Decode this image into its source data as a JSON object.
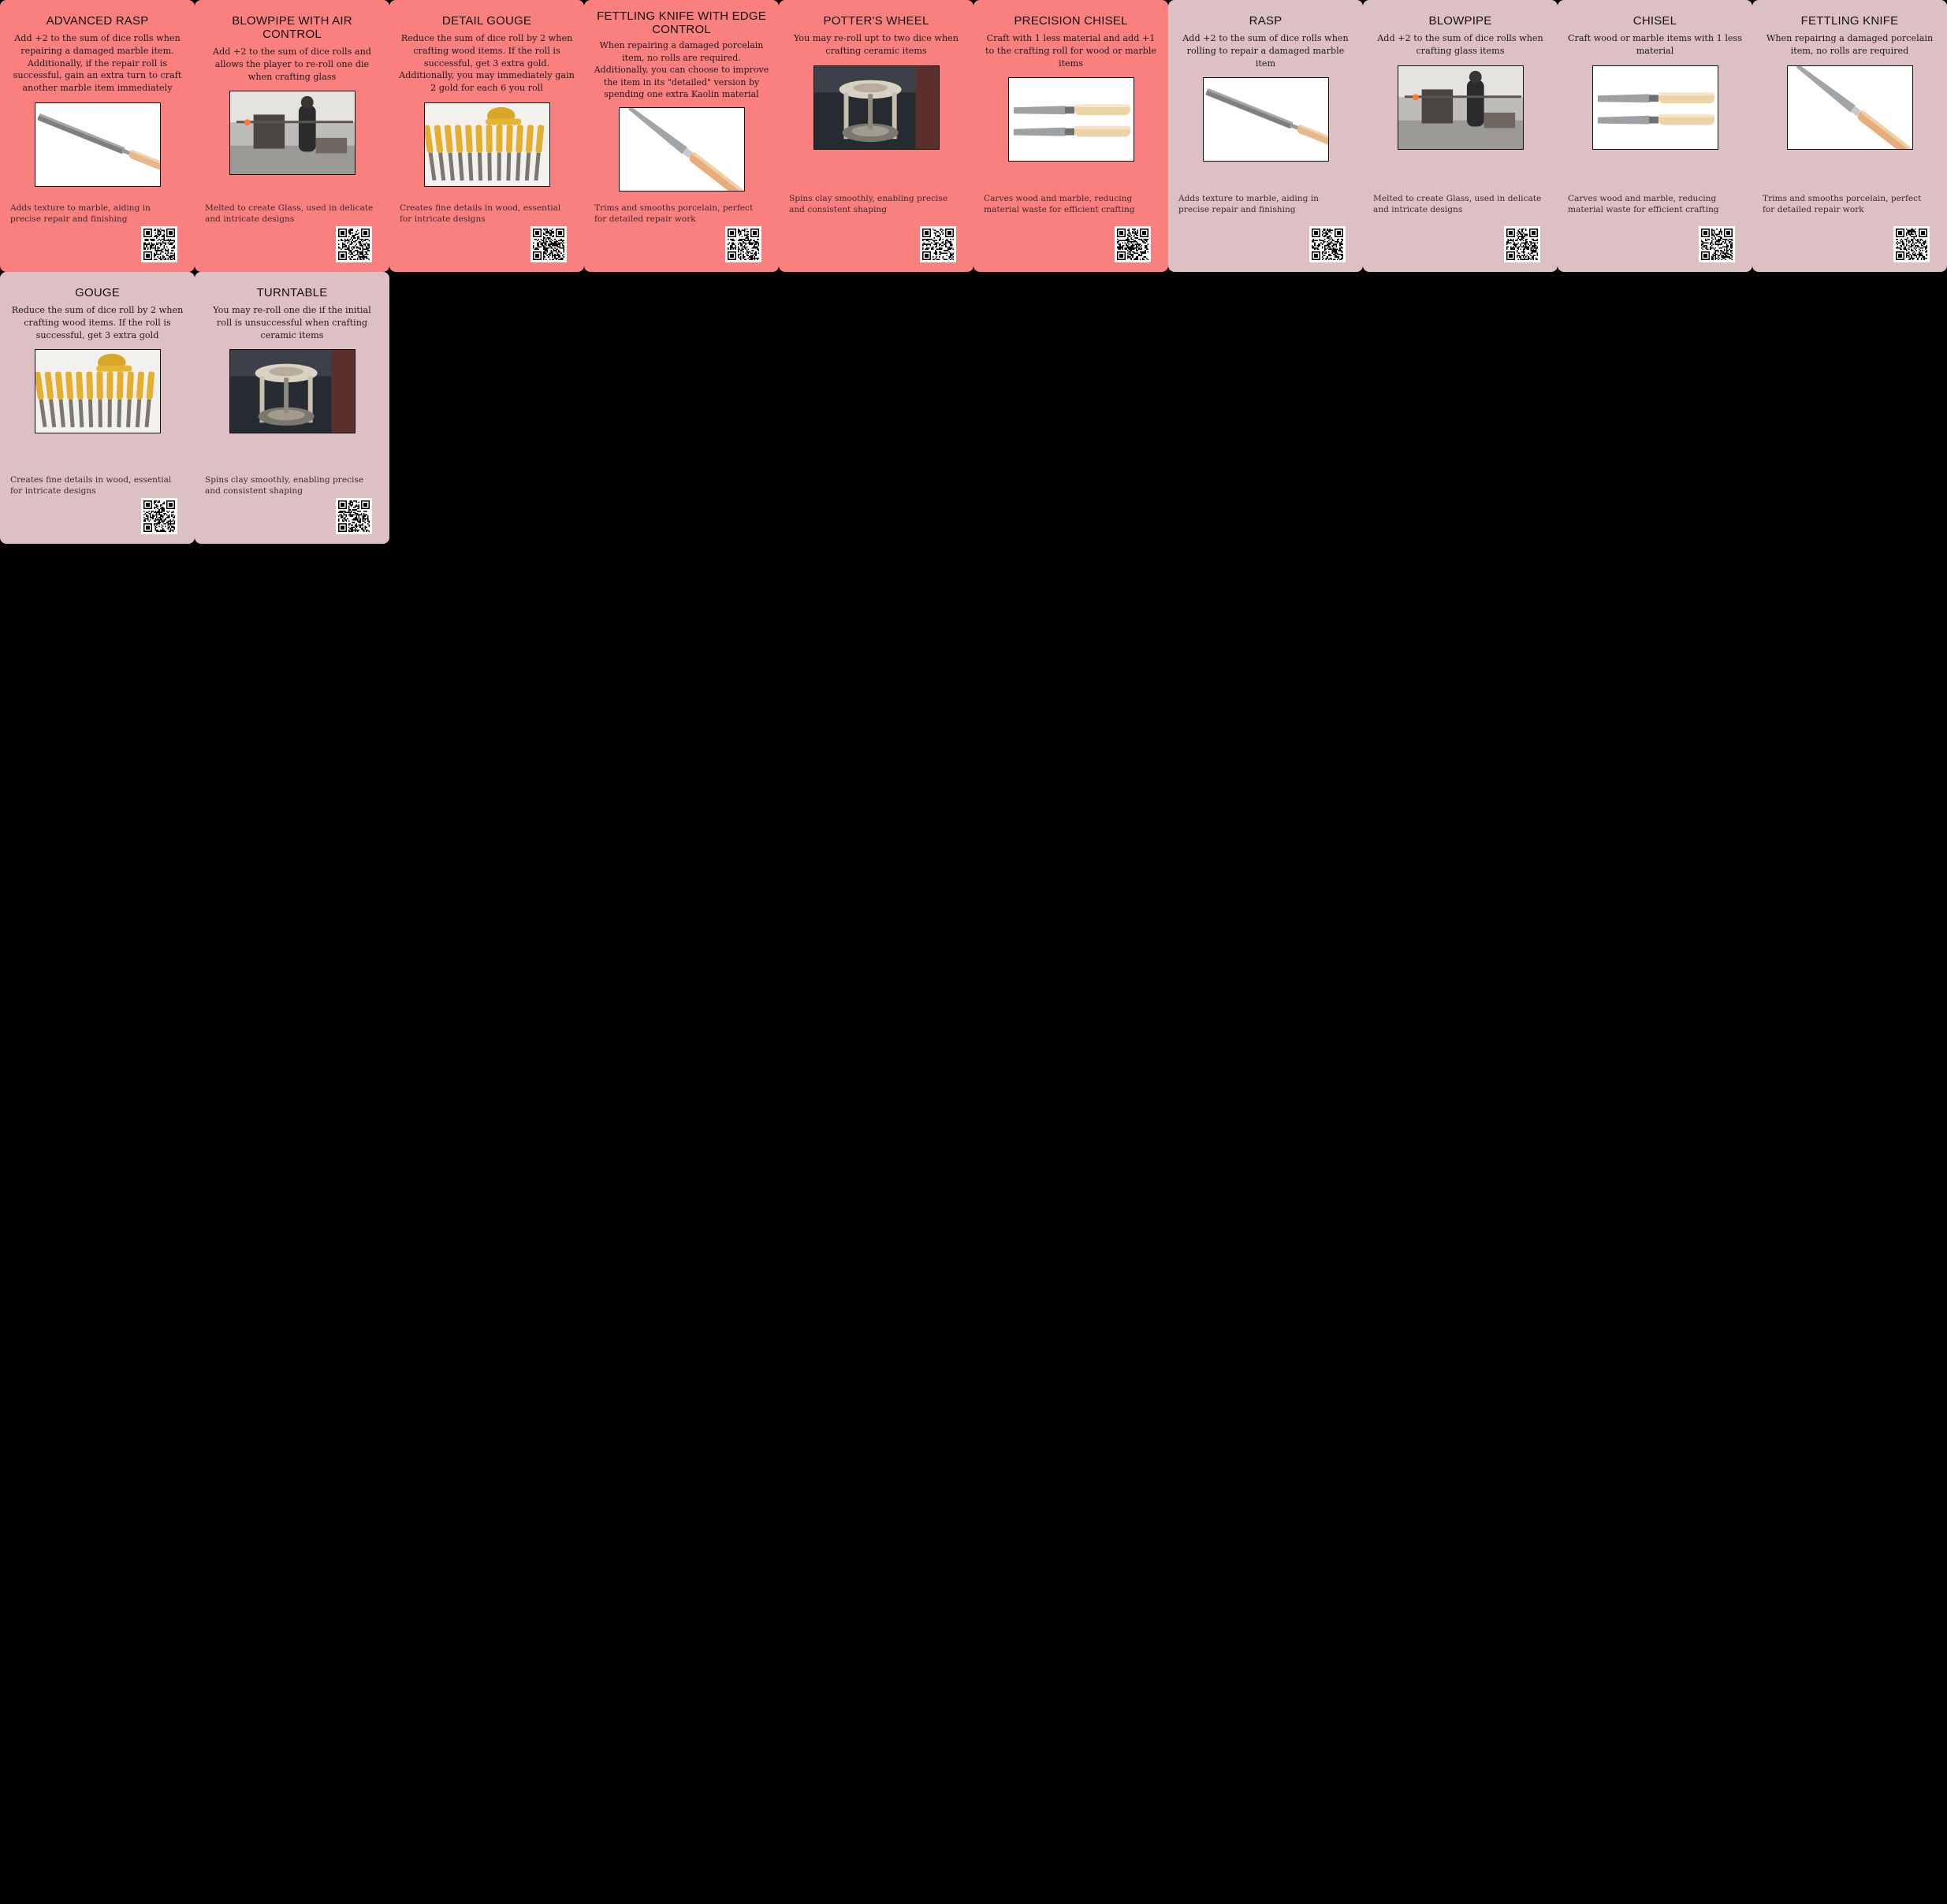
{
  "cards": [
    {
      "tier": "upgraded",
      "layout": "tall",
      "title": "ADVANCED RASP",
      "rule": "Add +2 to the sum of dice rolls when repairing a damaged marble item. Additionally, if the repair roll is successful, gain an extra turn to craft another marble item immediately",
      "image": "rasp-image",
      "flavor": "Adds texture to marble, aiding in precise repair and finishing",
      "qr": "qr-code-icon"
    },
    {
      "tier": "upgraded",
      "layout": "tall",
      "title": "BLOWPIPE WITH AIR CONTROL",
      "rule": "Add +2 to the sum of dice rolls and allows the player to re-roll one die when crafting glass",
      "image": "blowpipe-image",
      "flavor": "Melted to create Glass, used in delicate and intricate designs",
      "qr": "qr-code-icon"
    },
    {
      "tier": "upgraded",
      "layout": "tall",
      "title": "DETAIL GOUGE",
      "rule": "Reduce the sum of dice roll by 2 when crafting wood items. If the roll is successful, get 3 extra gold. Additionally, you may immediately gain 2 gold for each 6 you roll",
      "image": "gouge-image",
      "flavor": "Creates fine details in wood, essential for intricate designs",
      "qr": "qr-code-icon"
    },
    {
      "tier": "upgraded",
      "layout": "long",
      "title": "FETTLING KNIFE WITH EDGE CONTROL",
      "rule": "When repairing a damaged porcelain item, no rolls are required. Additionally, you can choose to improve the item in its \"detailed\" version by spending one extra Kaolin material",
      "image": "knife-image",
      "flavor": "Trims and smooths porcelain, perfect for detailed repair work",
      "qr": "qr-code-icon"
    },
    {
      "tier": "upgraded",
      "layout": "short",
      "title": "POTTER'S WHEEL",
      "rule": "You may re-roll upt to two dice when crafting ceramic items",
      "image": "wheel-image",
      "flavor": "Spins clay smoothly, enabling precise and consistent shaping",
      "qr": "qr-code-icon"
    },
    {
      "tier": "upgraded",
      "layout": "short",
      "title": "PRECISION CHISEL",
      "rule": "Craft with 1 less material and add +1 to the crafting roll for wood or marble items",
      "image": "chisel-image",
      "flavor": "Carves wood and marble, reducing material waste for efficient crafting",
      "qr": "qr-code-icon"
    },
    {
      "tier": "basic",
      "layout": "short",
      "title": "RASP",
      "rule": "Add +2 to the sum of dice rolls when rolling to repair a damaged marble item",
      "image": "rasp-image",
      "flavor": "Adds texture to marble, aiding in precise repair and finishing",
      "qr": "qr-code-icon"
    },
    {
      "tier": "basic",
      "layout": "short",
      "title": "BLOWPIPE",
      "rule": "Add +2 to the sum of dice rolls when crafting glass items",
      "image": "blowpipe-image",
      "flavor": "Melted to create Glass, used in delicate and intricate designs",
      "qr": "qr-code-icon"
    },
    {
      "tier": "basic",
      "layout": "short",
      "title": "CHISEL",
      "rule": "Craft wood or marble items with 1 less material",
      "image": "chisel-image",
      "flavor": "Carves wood and marble, reducing material waste for efficient crafting",
      "qr": "qr-code-icon"
    },
    {
      "tier": "basic",
      "layout": "short",
      "title": "FETTLING KNIFE",
      "rule": "When repairing a damaged porcelain item, no rolls are required",
      "image": "knife-image",
      "flavor": "Trims and smooths porcelain, perfect for detailed repair work",
      "qr": "qr-code-icon"
    },
    {
      "tier": "basic",
      "layout": "tall",
      "title": "GOUGE",
      "rule": "Reduce the sum of dice roll by 2 when crafting wood items. If the roll is successful, get 3 extra gold",
      "image": "gouge-image",
      "flavor": "Creates fine details in wood, essential for intricate designs",
      "qr": "qr-code-icon"
    },
    {
      "tier": "basic",
      "layout": "tall",
      "title": "TURNTABLE",
      "rule": "You may re-roll one die if the initial roll is unsuccessful when crafting ceramic items",
      "image": "wheel-image",
      "flavor": "Spins clay smoothly, enabling precise and consistent shaping",
      "qr": "qr-code-icon"
    }
  ],
  "colors": {
    "upgraded_card": "#fa8080",
    "basic_card": "#dcc0c3",
    "background": "#000000"
  }
}
